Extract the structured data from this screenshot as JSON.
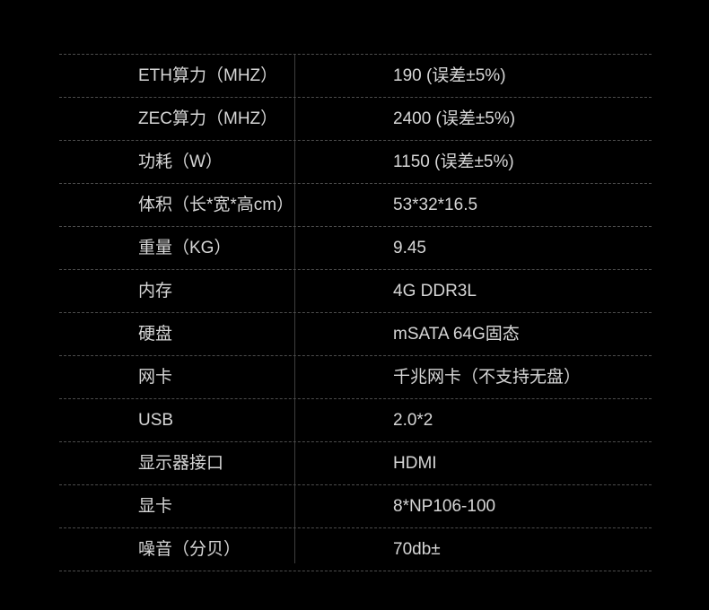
{
  "specs": [
    {
      "label": "ETH算力（MHZ）",
      "value": "190 (误差±5%)"
    },
    {
      "label": "ZEC算力（MHZ）",
      "value": "2400 (误差±5%)"
    },
    {
      "label": "功耗（W）",
      "value": "1150 (误差±5%)"
    },
    {
      "label": "体积（长*宽*高cm）",
      "value": "53*32*16.5"
    },
    {
      "label": "重量（KG）",
      "value": "9.45"
    },
    {
      "label": "内存",
      "value": "4G DDR3L"
    },
    {
      "label": "硬盘",
      "value": "mSATA 64G固态"
    },
    {
      "label": "网卡",
      "value": "千兆网卡（不支持无盘）"
    },
    {
      "label": "USB",
      "value": "2.0*2"
    },
    {
      "label": "显示器接口",
      "value": "HDMI"
    },
    {
      "label": "显卡",
      "value": "8*NP106-100"
    },
    {
      "label": "噪音（分贝）",
      "value": "70db±"
    }
  ]
}
